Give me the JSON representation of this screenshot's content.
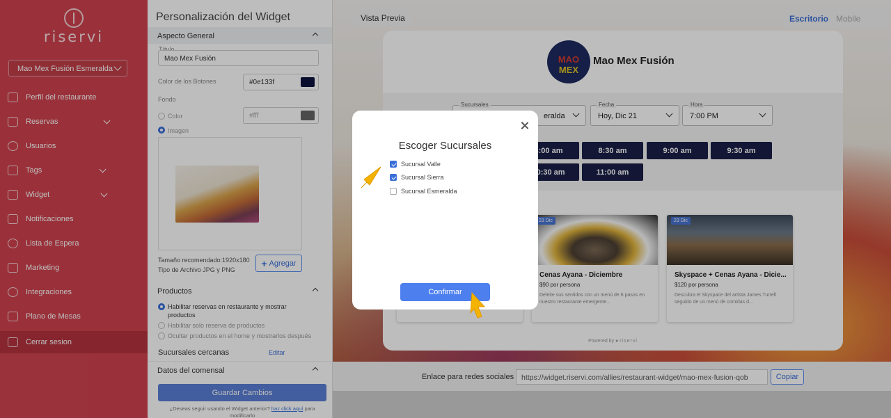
{
  "sidebar": {
    "logo_text": "riservi",
    "branch": "Mao Mex Fusión Esmeralda",
    "items": [
      {
        "label": "Perfil del restaurante"
      },
      {
        "label": "Reservas"
      },
      {
        "label": "Usuarios"
      },
      {
        "label": "Tags"
      },
      {
        "label": "Widget"
      },
      {
        "label": "Notificaciones"
      },
      {
        "label": "Lista de Espera"
      },
      {
        "label": "Marketing"
      },
      {
        "label": "Integraciones"
      },
      {
        "label": "Plano de Mesas"
      },
      {
        "label": "Cerrar sesion"
      }
    ]
  },
  "panel": {
    "title": "Personalización del Widget",
    "general": {
      "heading": "Aspecto General",
      "title_label": "Título",
      "title_value": "Mao Mex Fusión",
      "button_color_label": "Color de los Botones",
      "button_color_value": "#0e133f",
      "background_label": "Fondo",
      "opt_color": "Color",
      "opt_color_value": "#fff",
      "opt_image": "Imagen",
      "size_note": "Tamaño recomendado:1920x180",
      "type_note": "Tipo de Archivo JPG y PNG",
      "add_button": "Agregar"
    },
    "products": {
      "heading": "Productos",
      "opt1": "Habilitar reservas en restaurante y mostrar productos",
      "opt2": "Habilitar solo reserva de productos",
      "opt3": "Ocultar productos en el home y mostrarlos después"
    },
    "nearby": {
      "label": "Sucursales cercanas",
      "edit": "Editar"
    },
    "diner": {
      "heading": "Datos del comensal"
    },
    "save_button": "Guardar Cambios",
    "old_note_pre": "¿Deseas seguir usando el Widget anterior?",
    "old_note_link": "haz click aquí",
    "old_note_post": "para modificarlo"
  },
  "preview": {
    "label": "Vista Previa",
    "tab_desktop": "Escritorio",
    "tab_mobile": "Mobile",
    "restaurant_name": "Mao Mex Fusión",
    "logo_top": "MAO",
    "logo_bottom": "MEX",
    "branches_caption": "Sucursales",
    "branch_value": "eralda",
    "date_caption": "Fecha",
    "date_value": "Hoy, Dic 21",
    "time_caption": "Hora",
    "time_value": "7:00 PM",
    "slots": [
      "8:00 am",
      "8:30 am",
      "9:00 am",
      "9:30 am",
      "10:30 am",
      "11:00 am"
    ],
    "events": [
      {
        "badge": "23 Dic",
        "title": "Cenas Ayana - Diciembre",
        "price": "$90 por persona",
        "desc": "Deleite sus sentidos con un menú de 6 pasos  en nuestro restaurante emergente..."
      },
      {
        "badge": "23 Dic",
        "title": "Skyspace + Cenas Ayana - Dicie...",
        "price": "$120 por persona",
        "desc": "Descubra el Skyspace del artista James Turrell seguido de un menú de comidas d..."
      }
    ],
    "powered_by": "Powered by",
    "powered_brand": "riservi",
    "link_label": "Enlace para redes sociales",
    "link_value": "https://widget.riservi.com/allies/restaurant-widget/mao-mex-fusion-qob",
    "copy_button": "Copiar"
  },
  "modal": {
    "title": "Escoger Sucursales",
    "options": [
      {
        "label": "Sucursal Valle",
        "checked": true
      },
      {
        "label": "Sucursal Sierra",
        "checked": true
      },
      {
        "label": "Sucursal Esmeralda",
        "checked": false
      }
    ],
    "confirm_button": "Confirmar"
  },
  "colors": {
    "sidebar": "#d0434f",
    "button": "#0e133f",
    "accent": "#3a6fd8",
    "cursor": "#f5b301"
  }
}
